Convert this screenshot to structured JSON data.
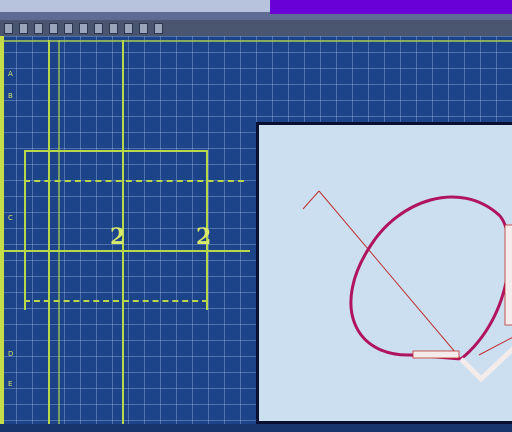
{
  "canvas": {
    "digits": [
      "2",
      "2"
    ],
    "side_marks": [
      "A",
      "B",
      "C",
      "D",
      "E"
    ]
  },
  "colors": {
    "background": "#1d4389",
    "grid": "#8caadc",
    "guide": "#b6d84a",
    "digit": "#d9ea6a",
    "preview_background": "#cbdff0",
    "curve": "#b0145f",
    "thin_line": "#c03030",
    "accent_bar": "#6a00d8"
  }
}
